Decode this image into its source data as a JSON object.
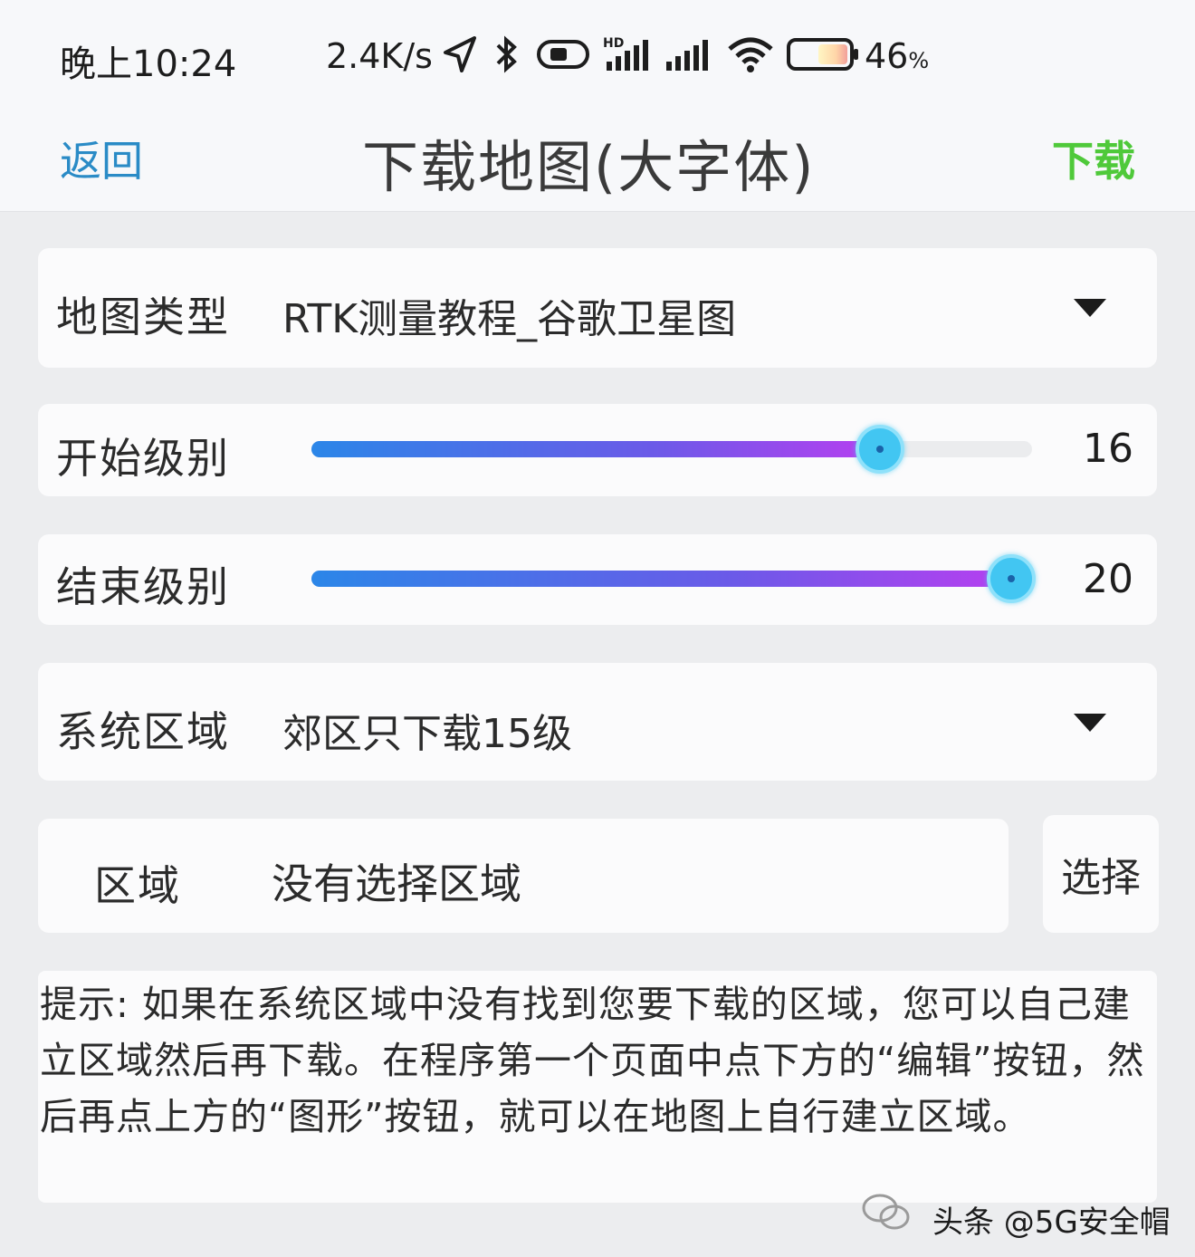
{
  "status_bar": {
    "time": "晚上10:24",
    "net_speed": "2.4K/s",
    "battery_pct": "46",
    "battery_unit": "%"
  },
  "nav": {
    "back_label": "返回",
    "title": "下载地图(大字体)",
    "download_label": "下载"
  },
  "map_type": {
    "label": "地图类型",
    "value": "RTK测量教程_谷歌卫星图"
  },
  "start_level": {
    "label": "开始级别",
    "value": "16",
    "fill_fraction": 0.81
  },
  "end_level": {
    "label": "结束级别",
    "value": "20",
    "fill_fraction": 1.0
  },
  "system_area": {
    "label": "系统区域",
    "value": "郊区只下载15级"
  },
  "area": {
    "label": "区域",
    "value": "没有选择区域",
    "select_label": "选择"
  },
  "hint": {
    "text": "提示: 如果在系统区域中没有找到您要下载的区域，您可以自己建立区域然后再下载。在程序第一个页面中点下方的“编辑”按钮，然后再点上方的“图形”按钮，就可以在地图上自行建立区域。"
  },
  "watermark": {
    "text": "头条 @5G安全帽"
  },
  "colors": {
    "back": "#2a8bc6",
    "download": "#4fc93a",
    "thumb": "#42c6f2"
  }
}
